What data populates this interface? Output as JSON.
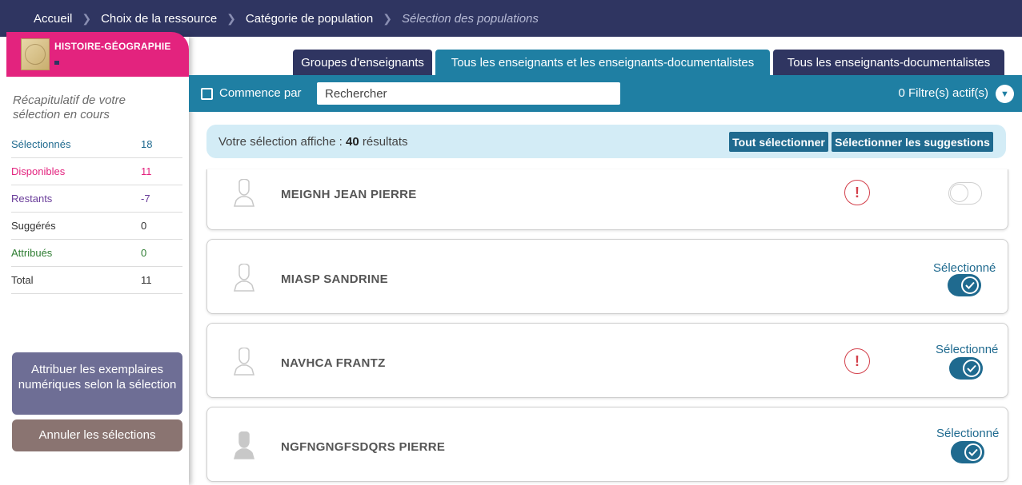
{
  "breadcrumb": [
    {
      "label": "Accueil"
    },
    {
      "label": "Choix de la ressource"
    },
    {
      "label": "Catégorie de population"
    },
    {
      "label": "Sélection des populations"
    }
  ],
  "sidebar": {
    "resource_title": "HISTOIRE-GÉOGRAPHIE",
    "recap": "Récapitulatif de votre sélection en cours",
    "stats": [
      {
        "label": "Sélectionnés",
        "value": "18",
        "color": "#1f6a8f"
      },
      {
        "label": "Disponibles",
        "value": "11",
        "color": "#e3237e"
      },
      {
        "label": "Restants",
        "value": "-7",
        "color": "#6a3d9a"
      },
      {
        "label": "Suggérés",
        "value": "0",
        "color": "#333333"
      },
      {
        "label": "Attribués",
        "value": "0",
        "color": "#2e7d32"
      },
      {
        "label": "Total",
        "value": "11",
        "color": "#333333"
      }
    ],
    "assign_button": "Attribuer les exemplaires numériques selon la sélection",
    "cancel_button": "Annuler les sélections"
  },
  "tabs": [
    {
      "label": "Groupes d'enseignants",
      "active": false
    },
    {
      "label": "Tous les enseignants et les enseignants-documentalistes",
      "active": true
    },
    {
      "label": "Tous les enseignants-documentalistes",
      "active": false
    }
  ],
  "filter": {
    "checkbox_label": "Commence par",
    "search_placeholder": "Rechercher",
    "active_filters": "0 Filtre(s) actif(s)"
  },
  "results": {
    "prefix": "Votre sélection affiche : ",
    "count": "40",
    "suffix": " résultats",
    "select_all": "Tout sélectionner",
    "select_suggestions": "Sélectionner les suggestions"
  },
  "people": [
    {
      "name": "MEIGNH JEAN PIERRE",
      "warning": true,
      "selected": false,
      "selected_label": ""
    },
    {
      "name": "MIASP SANDRINE",
      "warning": false,
      "selected": true,
      "selected_label": "Sélectionné"
    },
    {
      "name": "NAVHCA FRANTZ",
      "warning": true,
      "selected": true,
      "selected_label": "Sélectionné"
    },
    {
      "name": "NGFNGNGFSDQRS PIERRE",
      "warning": false,
      "selected": true,
      "selected_label": "Sélectionné"
    }
  ],
  "colors": {
    "navy": "#2f3561",
    "teal": "#1f7fa3",
    "pink": "#e3237e",
    "warning": "#d3404b"
  }
}
